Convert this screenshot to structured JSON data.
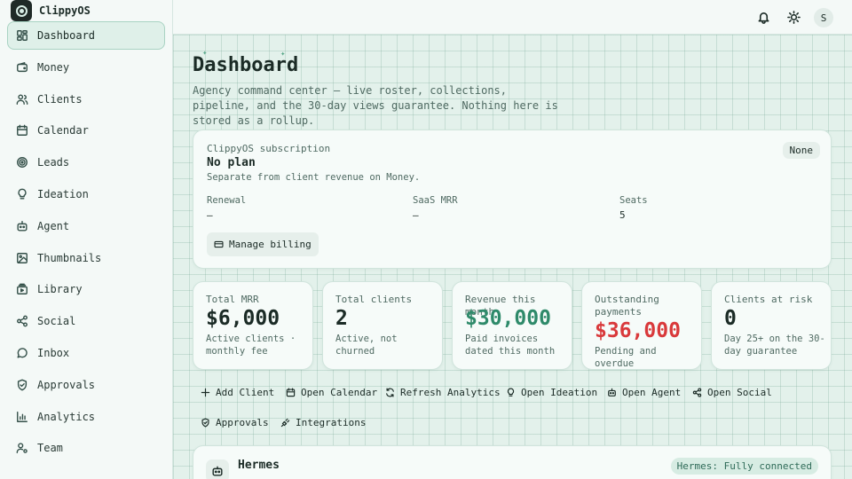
{
  "brand": {
    "name": "ClippyOS"
  },
  "sidebar": {
    "items": [
      {
        "label": "Dashboard",
        "icon": "dashboard-icon",
        "active": true
      },
      {
        "label": "Money",
        "icon": "wallet-icon"
      },
      {
        "label": "Clients",
        "icon": "users-icon"
      },
      {
        "label": "Calendar",
        "icon": "calendar-icon"
      },
      {
        "label": "Leads",
        "icon": "target-icon"
      },
      {
        "label": "Ideation",
        "icon": "lightbulb-icon"
      },
      {
        "label": "Agent",
        "icon": "bot-icon"
      },
      {
        "label": "Thumbnails",
        "icon": "image-icon"
      },
      {
        "label": "Library",
        "icon": "library-icon"
      },
      {
        "label": "Social",
        "icon": "share-icon"
      },
      {
        "label": "Inbox",
        "icon": "message-icon"
      },
      {
        "label": "Approvals",
        "icon": "shield-check-icon"
      },
      {
        "label": "Analytics",
        "icon": "bar-chart-icon"
      },
      {
        "label": "Team",
        "icon": "user-gear-icon"
      }
    ]
  },
  "topbar": {
    "avatar_initial": "S"
  },
  "page": {
    "title": "Dashboard",
    "description": "Agency command center — live roster, collections, pipeline, and the 30-day views guarantee. Nothing here is stored as a rollup."
  },
  "subscription": {
    "label": "ClippyOS subscription",
    "plan": "No plan",
    "note": "Separate from client revenue on Money.",
    "badge": "None",
    "renewal_label": "Renewal",
    "renewal_value": "—",
    "mrr_label": "SaaS MRR",
    "mrr_value": "—",
    "seats_label": "Seats",
    "seats_value": "5",
    "billing_button": "Manage billing"
  },
  "kpis": [
    {
      "label": "Total MRR",
      "value": "$6,000",
      "sub": "Active clients · monthly fee",
      "color": "#1b2b26"
    },
    {
      "label": "Total clients",
      "value": "2",
      "sub": "Active, not churned",
      "color": "#1b2b26"
    },
    {
      "label": "Revenue this month",
      "value": "$30,000",
      "sub": "Paid invoices dated this month",
      "color": "#2e8a6a"
    },
    {
      "label": "Outstanding payments",
      "value": "$36,000",
      "sub": "Pending and overdue",
      "color": "#d9393b"
    },
    {
      "label": "Clients at risk",
      "value": "0",
      "sub": "Day 25+ on the 30-day guarantee",
      "color": "#1b2b26"
    }
  ],
  "actions": [
    {
      "label": "Add Client",
      "icon": "plus-icon"
    },
    {
      "label": "Open Calendar",
      "icon": "calendar-icon"
    },
    {
      "label": "Refresh Analytics",
      "icon": "refresh-icon"
    },
    {
      "label": "Open Ideation",
      "icon": "lightbulb-icon"
    },
    {
      "label": "Open Agent",
      "icon": "bot-icon"
    },
    {
      "label": "Open Social",
      "icon": "share-icon"
    },
    {
      "label": "Approvals",
      "icon": "shield-check-icon"
    },
    {
      "label": "Integrations",
      "icon": "plug-icon"
    }
  ],
  "hermes": {
    "title": "Hermes",
    "status": "Hermes: Fully connected"
  }
}
